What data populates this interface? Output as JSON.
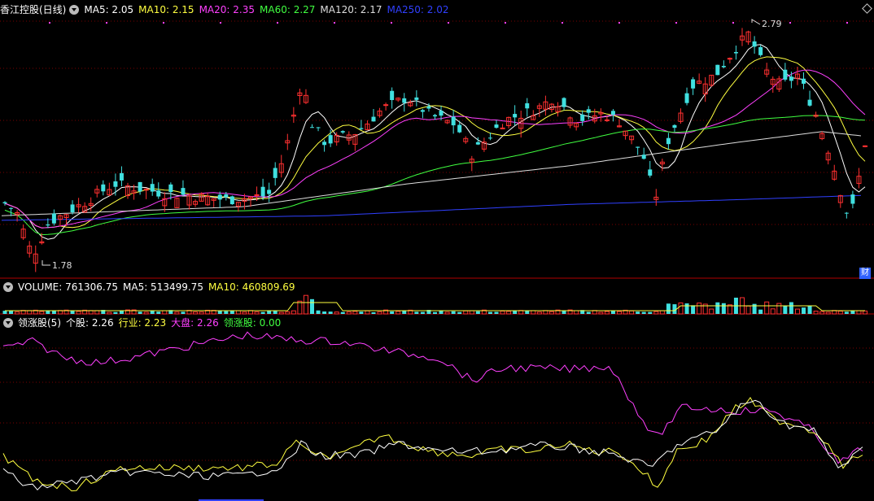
{
  "main": {
    "title": "香江控股(日线)",
    "ma_items": [
      {
        "label": "MA5: 2.05",
        "color": "#ffffff"
      },
      {
        "label": "MA10: 2.15",
        "color": "#ffff40"
      },
      {
        "label": "MA20: 2.35",
        "color": "#ff40ff"
      },
      {
        "label": "MA60: 2.27",
        "color": "#40ff40"
      },
      {
        "label": "MA120: 2.17",
        "color": "#dddddd"
      },
      {
        "label": "MA250: 2.02",
        "color": "#3040ff"
      }
    ],
    "high_label": "2.79",
    "low_label": "1.78",
    "cai_label": "财"
  },
  "volume": {
    "items": [
      {
        "label": "VOLUME: 761306.75",
        "color": "#ffffff"
      },
      {
        "label": "MA5: 513499.75",
        "color": "#ffffff"
      },
      {
        "label": "MA10: 460809.69",
        "color": "#ffff40"
      }
    ]
  },
  "indicator": {
    "items": [
      {
        "label": "领涨股(5)",
        "color": "#ffffff"
      },
      {
        "label": "个股: 2.26",
        "color": "#ffffff"
      },
      {
        "label": "行业: 2.23",
        "color": "#ffff40"
      },
      {
        "label": "大盘: 2.26",
        "color": "#ff40ff"
      },
      {
        "label": "领涨股: 0.00",
        "color": "#40ff40"
      }
    ]
  },
  "colors": {
    "up": "#ff3030",
    "down": "#40e0e0",
    "bg": "#000000",
    "grid": "#8b0000"
  }
}
